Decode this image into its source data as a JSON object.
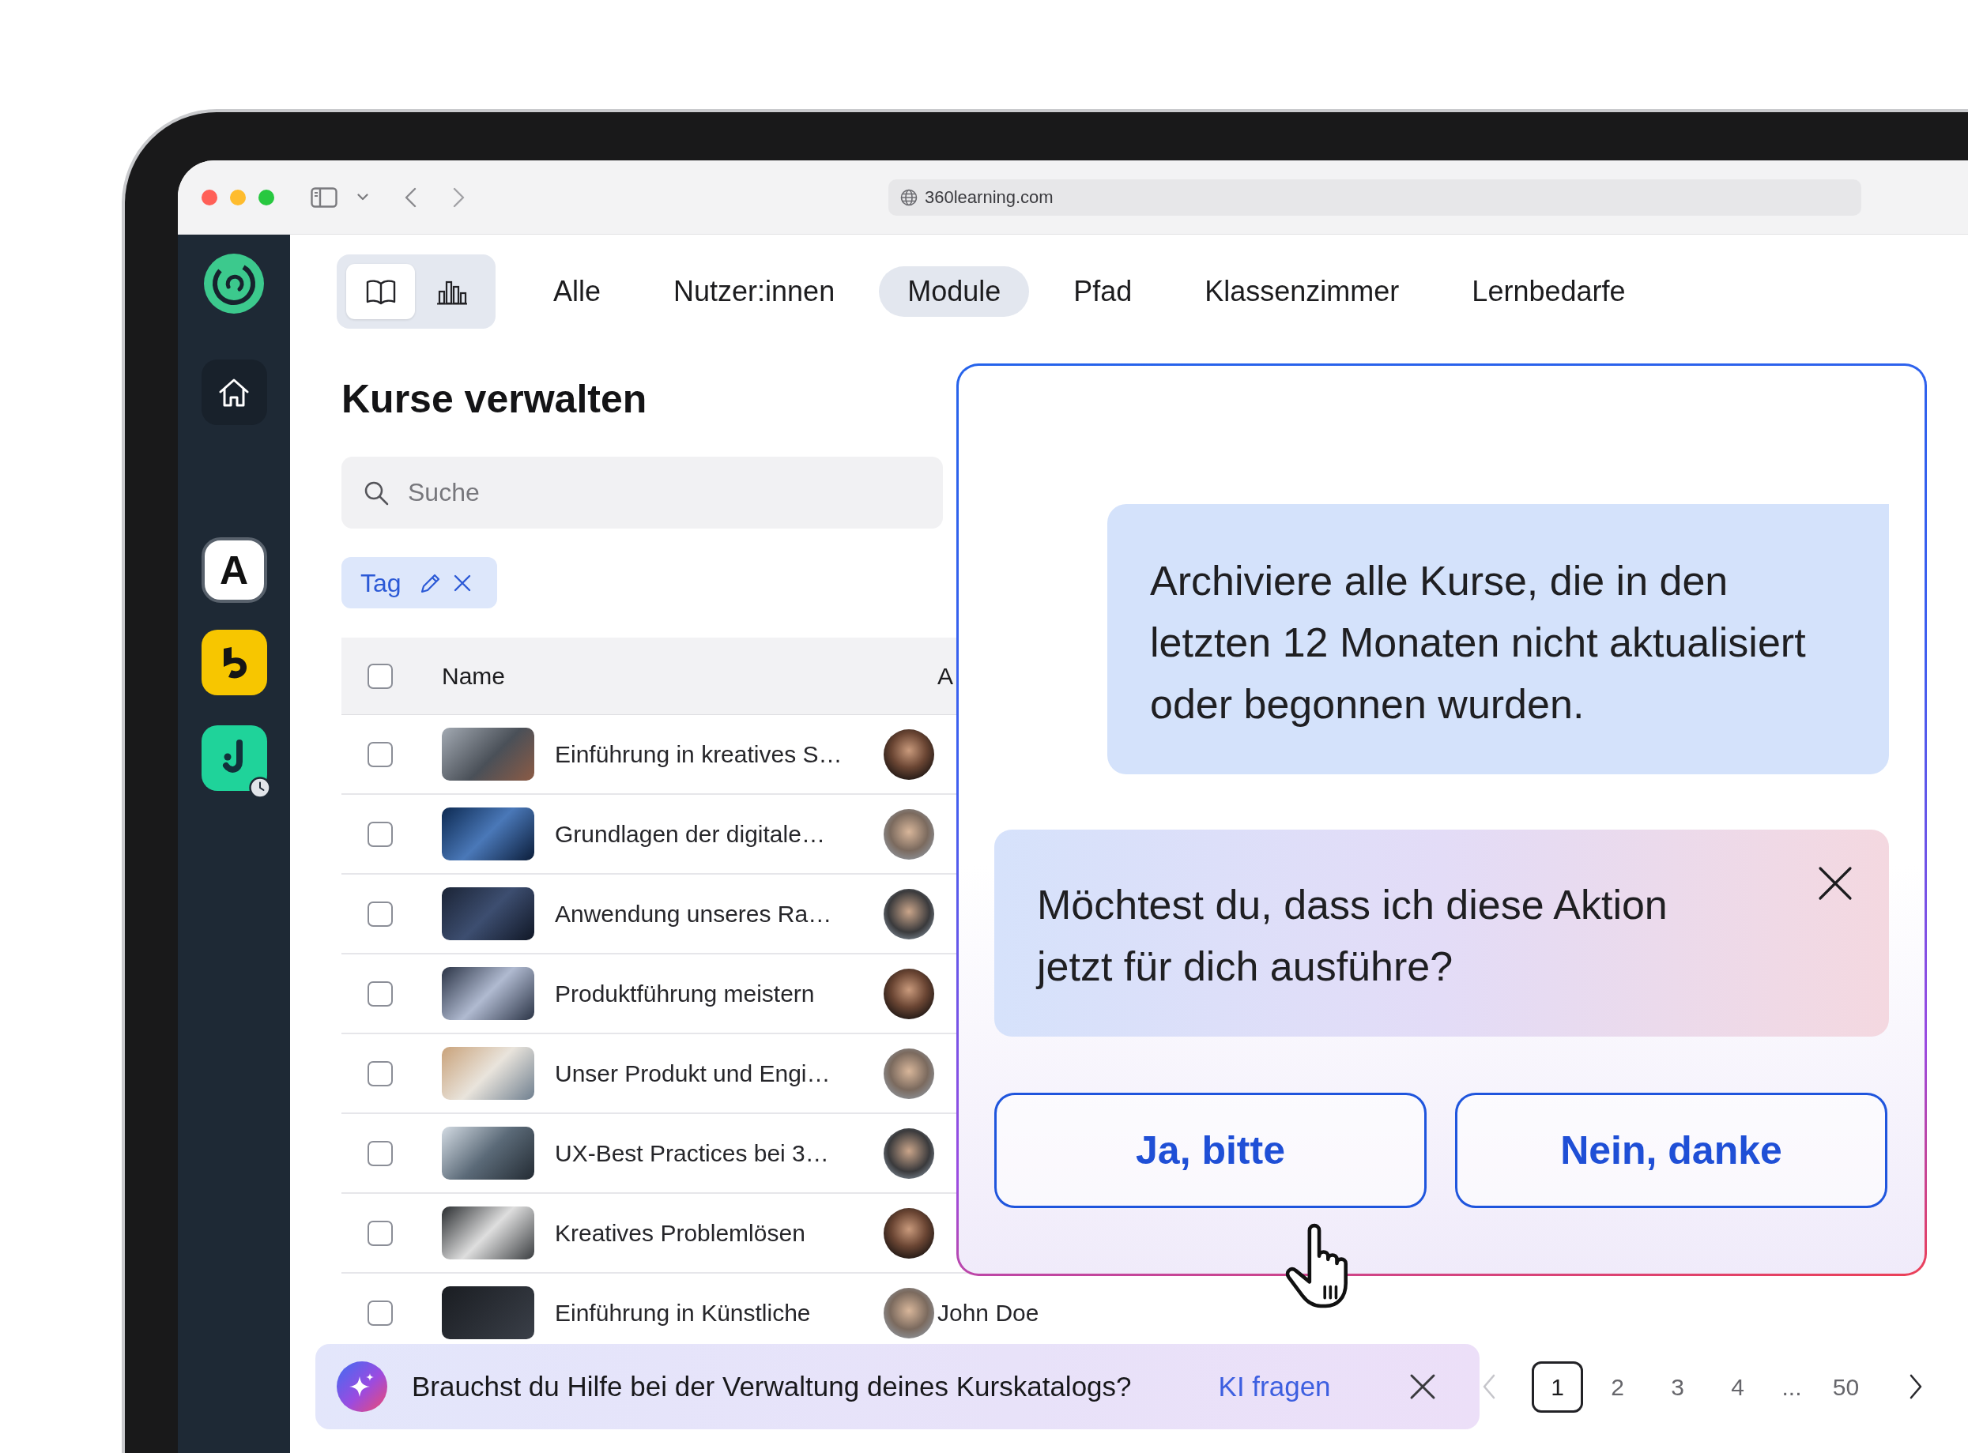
{
  "browser": {
    "url": "360learning.com"
  },
  "sidebar": {
    "workspace_tile": "A"
  },
  "view_switch": [
    {
      "selected": true
    },
    {
      "selected": false
    }
  ],
  "tabs": [
    {
      "label": "Alle",
      "selected": false
    },
    {
      "label": "Nutzer:innen",
      "selected": false
    },
    {
      "label": "Module",
      "selected": true
    },
    {
      "label": "Pfad",
      "selected": false
    },
    {
      "label": "Klassenzimmer",
      "selected": false
    },
    {
      "label": "Lernbedarfe",
      "selected": false
    }
  ],
  "page_title": "Kurse verwalten",
  "search": {
    "placeholder": "Suche"
  },
  "filter_chips": [
    {
      "label": "Tag"
    }
  ],
  "table": {
    "select_all_checked": false,
    "columns": [
      {
        "label": "Name"
      },
      {
        "label": "A"
      }
    ],
    "rows": [
      {
        "checked": false,
        "name": "Einführung in kreatives S…"
      },
      {
        "checked": false,
        "name": "Grundlagen der digitale…"
      },
      {
        "checked": false,
        "name": "Anwendung unseres Ra…"
      },
      {
        "checked": false,
        "name": "Produktführung meistern"
      },
      {
        "checked": false,
        "name": "Unser Produkt und Engi…"
      },
      {
        "checked": false,
        "name": "UX-Best Practices bei 3…"
      },
      {
        "checked": false,
        "name": "Kreatives Problemlösen"
      },
      {
        "checked": false,
        "name": "Einführung in Künstliche",
        "author": "John Doe"
      }
    ]
  },
  "assistant_dialog": {
    "user_message": "Archiviere alle Kurse, die in den letzten 12 Monaten nicht aktualisiert oder begonnen wurden.",
    "prompt": "Möchtest du, dass ich diese Aktion jetzt für dich ausführe?",
    "buttons": [
      {
        "label": "Ja, bitte"
      },
      {
        "label": "Nein, danke"
      }
    ]
  },
  "help_banner": {
    "text": "Brauchst du Hilfe bei der Verwaltung deines Kurskatalogs?",
    "link": "KI fragen"
  },
  "pagination": {
    "prev_disabled": true,
    "pages": [
      {
        "label": "1",
        "selected": true
      },
      {
        "label": "2",
        "selected": false
      },
      {
        "label": "3",
        "selected": false
      },
      {
        "label": "4",
        "selected": false
      }
    ],
    "gap": "...",
    "last_page": {
      "label": "50",
      "selected": false
    },
    "next_disabled": false
  }
}
